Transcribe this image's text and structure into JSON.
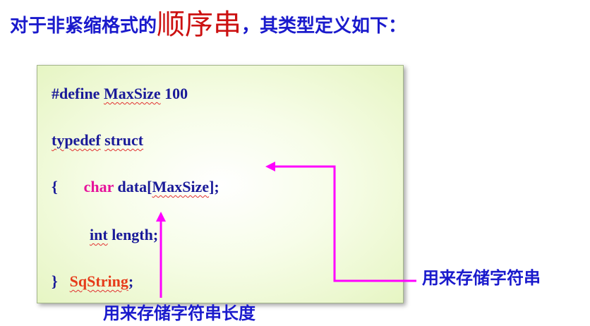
{
  "title": {
    "prefix": "对于非紧缩格式的",
    "emphasis": "顺序串",
    "suffix": "，其类型定义如下："
  },
  "code": {
    "line1": {
      "directive": "#define",
      "name": "MaxSize",
      "value": "100"
    },
    "line2": {
      "kw1": "typedef",
      "kw2": "struct"
    },
    "line3": {
      "brace": "{",
      "type": "char",
      "field": "data",
      "bracket_open": "[",
      "size": "MaxSize",
      "bracket_close": "];"
    },
    "line4": {
      "type": "int",
      "field": "length;"
    },
    "line5": {
      "brace": "}",
      "name": "SqString",
      "semicolon": ";"
    }
  },
  "annotations": {
    "string_storage": "用来存储字符串",
    "length_storage": "用来存储字符串长度"
  },
  "colors": {
    "title": "#1a1acc",
    "emphasis": "#cc1111",
    "code": "#1a1a99",
    "keyword_pink": "#e6139b",
    "typename_red": "#e63b1a",
    "arrow": "#ff00ff",
    "box_fill": "#e6f5c3"
  }
}
